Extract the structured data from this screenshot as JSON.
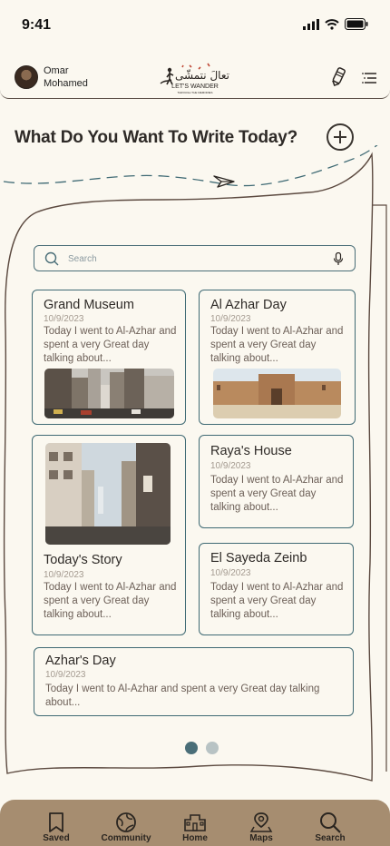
{
  "status": {
    "time": "9:41"
  },
  "header": {
    "user_name": "Omar Mohamed",
    "logo_arabic": "تعالَ نتمشّى",
    "logo_english": "LET'S WANDER",
    "logo_tagline": "THROUGH THE MEMORIES"
  },
  "prompt": {
    "title": "What Do You Want To Write Today?"
  },
  "search": {
    "placeholder": "Search"
  },
  "cards": [
    {
      "title": "Grand Museum",
      "date": "10/9/2023",
      "text": "Today I went to Al-Azhar and spent a very Great day talking about..."
    },
    {
      "title": "Al Azhar Day",
      "date": "10/9/2023",
      "text": "Today I went to Al-Azhar and spent a very Great day talking about..."
    },
    {
      "title": "Today's Story",
      "date": "10/9/2023",
      "text": "Today I went to Al-Azhar and spent a very Great day talking about..."
    },
    {
      "title": "Raya's House",
      "date": "10/9/2023",
      "text": "Today I went to Al-Azhar and spent a very Great day talking about..."
    },
    {
      "title": "El Sayeda Zeinb",
      "date": "10/9/2023",
      "text": "Today I went to Al-Azhar and spent a very Great day talking about..."
    },
    {
      "title": "Azhar's Day",
      "date": "10/9/2023",
      "text": "Today I went to Al-Azhar and spent a very Great day talking about..."
    }
  ],
  "pagination": {
    "pages": 2,
    "current": 1,
    "active_color": "#4a6e78",
    "inactive_color": "#b8c3c4"
  },
  "tabs": [
    {
      "label": "Saved",
      "icon": "bookmark-icon"
    },
    {
      "label": "Community",
      "icon": "globe-icon"
    },
    {
      "label": "Home",
      "icon": "home-icon"
    },
    {
      "label": "Maps",
      "icon": "map-icon"
    },
    {
      "label": "Search",
      "icon": "search-icon"
    }
  ],
  "colors": {
    "accent": "#4a6e78",
    "tabbar": "#a68d70",
    "background": "#fbf8f0"
  }
}
